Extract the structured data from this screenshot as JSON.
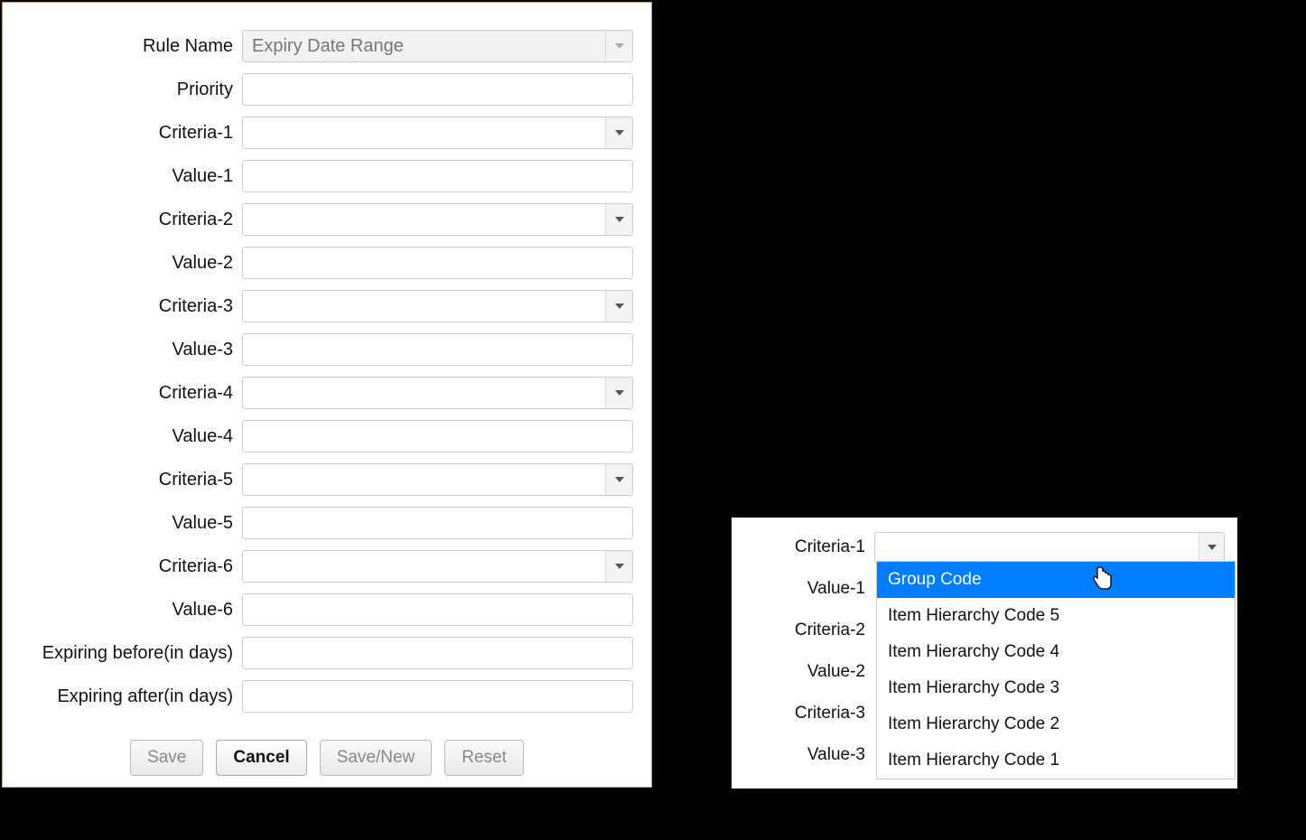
{
  "form": {
    "rule_name": {
      "label": "Rule Name",
      "value": "Expiry Date Range"
    },
    "priority": {
      "label": "Priority",
      "value": ""
    },
    "criteria1": {
      "label": "Criteria-1",
      "value": ""
    },
    "value1": {
      "label": "Value-1",
      "value": ""
    },
    "criteria2": {
      "label": "Criteria-2",
      "value": ""
    },
    "value2": {
      "label": "Value-2",
      "value": ""
    },
    "criteria3": {
      "label": "Criteria-3",
      "value": ""
    },
    "value3": {
      "label": "Value-3",
      "value": ""
    },
    "criteria4": {
      "label": "Criteria-4",
      "value": ""
    },
    "value4": {
      "label": "Value-4",
      "value": ""
    },
    "criteria5": {
      "label": "Criteria-5",
      "value": ""
    },
    "value5": {
      "label": "Value-5",
      "value": ""
    },
    "criteria6": {
      "label": "Criteria-6",
      "value": ""
    },
    "value6": {
      "label": "Value-6",
      "value": ""
    },
    "expiring_before": {
      "label": "Expiring before(in days)",
      "value": ""
    },
    "expiring_after": {
      "label": "Expiring after(in days)",
      "value": ""
    }
  },
  "buttons": {
    "save": "Save",
    "cancel": "Cancel",
    "save_new": "Save/New",
    "reset": "Reset"
  },
  "snippet": {
    "labels": {
      "criteria1": "Criteria-1",
      "value1": "Value-1",
      "criteria2": "Criteria-2",
      "value2": "Value-2",
      "criteria3": "Criteria-3",
      "value3": "Value-3"
    },
    "dropdown_options": [
      "Group Code",
      "Item Hierarchy Code 5",
      "Item Hierarchy Code 4",
      "Item Hierarchy Code 3",
      "Item Hierarchy Code 2",
      "Item Hierarchy Code 1"
    ],
    "selected_index": 0
  }
}
